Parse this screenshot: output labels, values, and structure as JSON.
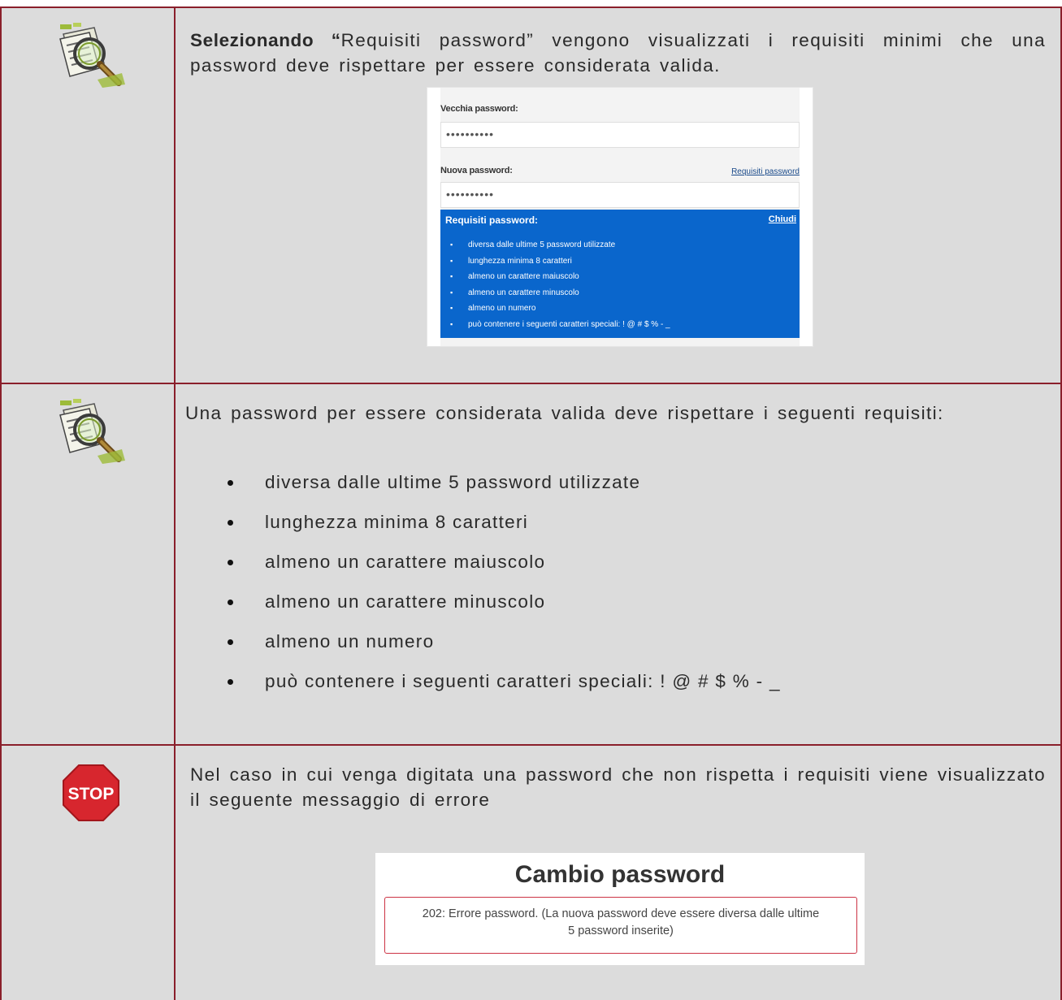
{
  "rows": [
    {
      "icon": "magnifier-document-icon",
      "text_bold": "Selezionando “",
      "text_rest": "Requisiti password” vengono visualizzati i requisiti minimi che una password deve rispettare per essere considerata valida.",
      "screenshot": {
        "old_label": "Vecchia password:",
        "old_value": "••••••••••",
        "new_label": "Nuova password:",
        "new_value": "••••••••••",
        "req_link": "Requisiti password",
        "panel_title": "Requisiti password:",
        "panel_close": "Chiudi",
        "items": [
          "diversa dalle ultime 5 password utilizzate",
          "lunghezza minima 8 caratteri",
          "almeno un carattere maiuscolo",
          "almeno un carattere minuscolo",
          "almeno un numero",
          "può contenere i seguenti caratteri speciali: ! @ # $ % - _"
        ]
      }
    },
    {
      "icon": "magnifier-document-icon",
      "text": "Una password per essere considerata valida deve rispettare i seguenti requisiti:",
      "items": [
        "diversa dalle ultime 5 password utilizzate",
        "lunghezza minima 8 caratteri",
        "almeno un carattere maiuscolo",
        "almeno un carattere minuscolo",
        "almeno un numero",
        "può contenere i seguenti caratteri speciali:  ! @ # $ % - _"
      ]
    },
    {
      "icon": "stop-sign-icon",
      "stop_label": "STOP",
      "text": "Nel caso in cui venga digitata una password che non rispetta i requisiti viene visualizzato il seguente messaggio di errore",
      "screenshot": {
        "title": "Cambio password",
        "error": "202: Errore password. (La nuova password deve essere diversa dalle ultime 5 password inserite)"
      }
    }
  ],
  "colors": {
    "border": "#8a1f2b",
    "background": "#dcdcdc",
    "panel_blue": "#0a66cc",
    "error_border": "#cc3344",
    "stop_red": "#d7262e"
  }
}
